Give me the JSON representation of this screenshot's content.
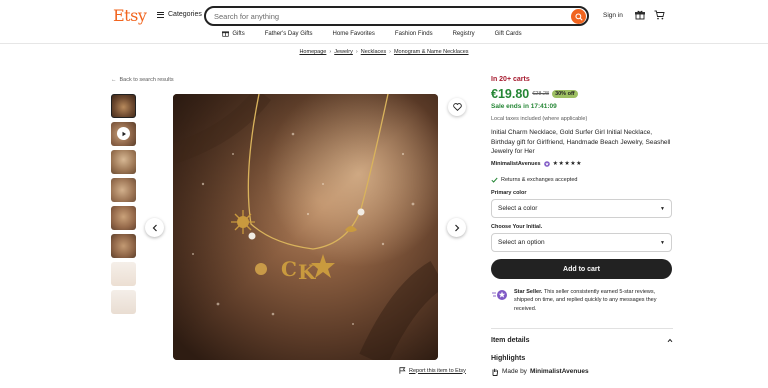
{
  "header": {
    "logo": "Etsy",
    "categories_label": "Categories",
    "search_placeholder": "Search for anything",
    "signin_label": "Sign in",
    "nav": [
      {
        "label": "Gifts",
        "icon": "gift-icon"
      },
      {
        "label": "Father's Day Gifts"
      },
      {
        "label": "Home Favorites"
      },
      {
        "label": "Fashion Finds"
      },
      {
        "label": "Registry"
      },
      {
        "label": "Gift Cards"
      }
    ]
  },
  "breadcrumb": [
    "Homepage",
    "Jewelry",
    "Necklaces",
    "Monogram & Name Necklaces"
  ],
  "back_link": "Back to search results",
  "report_link": "Report this item to Etsy",
  "product": {
    "carts": "In 20+ carts",
    "price": "€19.80",
    "original_price": "€28.28",
    "discount": "30% off",
    "sale_ends": "Sale ends in 17:41:09",
    "tax_note": "Local taxes included (where applicable)",
    "title": "Initial Charm Necklace, Gold Surfer Girl Initial Necklace, Birthday gift for Girlfriend, Handmade Beach Jewelry, Seashell Jewelry for Her",
    "shop_name": "MinimalistAvenues",
    "rating": "★★★★★",
    "returns": "Returns & exchanges accepted",
    "primary_color_label": "Primary color",
    "primary_color_value": "Select a color",
    "initial_label": "Choose Your Initial.",
    "initial_value": "Select an option",
    "add_to_cart": "Add to cart",
    "star_seller_title": "Star Seller.",
    "star_seller_text": "This seller consistently earned 5-star reviews, shipped on time, and replied quickly to any messages they received.",
    "item_details": "Item details",
    "highlights": "Highlights",
    "made_by_prefix": "Made by",
    "made_by_shop": "MinimalistAvenues"
  },
  "colors": {
    "brand": "#f1641e",
    "sale_green": "#258635",
    "carts_red": "#a61a2e",
    "discount_bg": "#9ec063"
  }
}
